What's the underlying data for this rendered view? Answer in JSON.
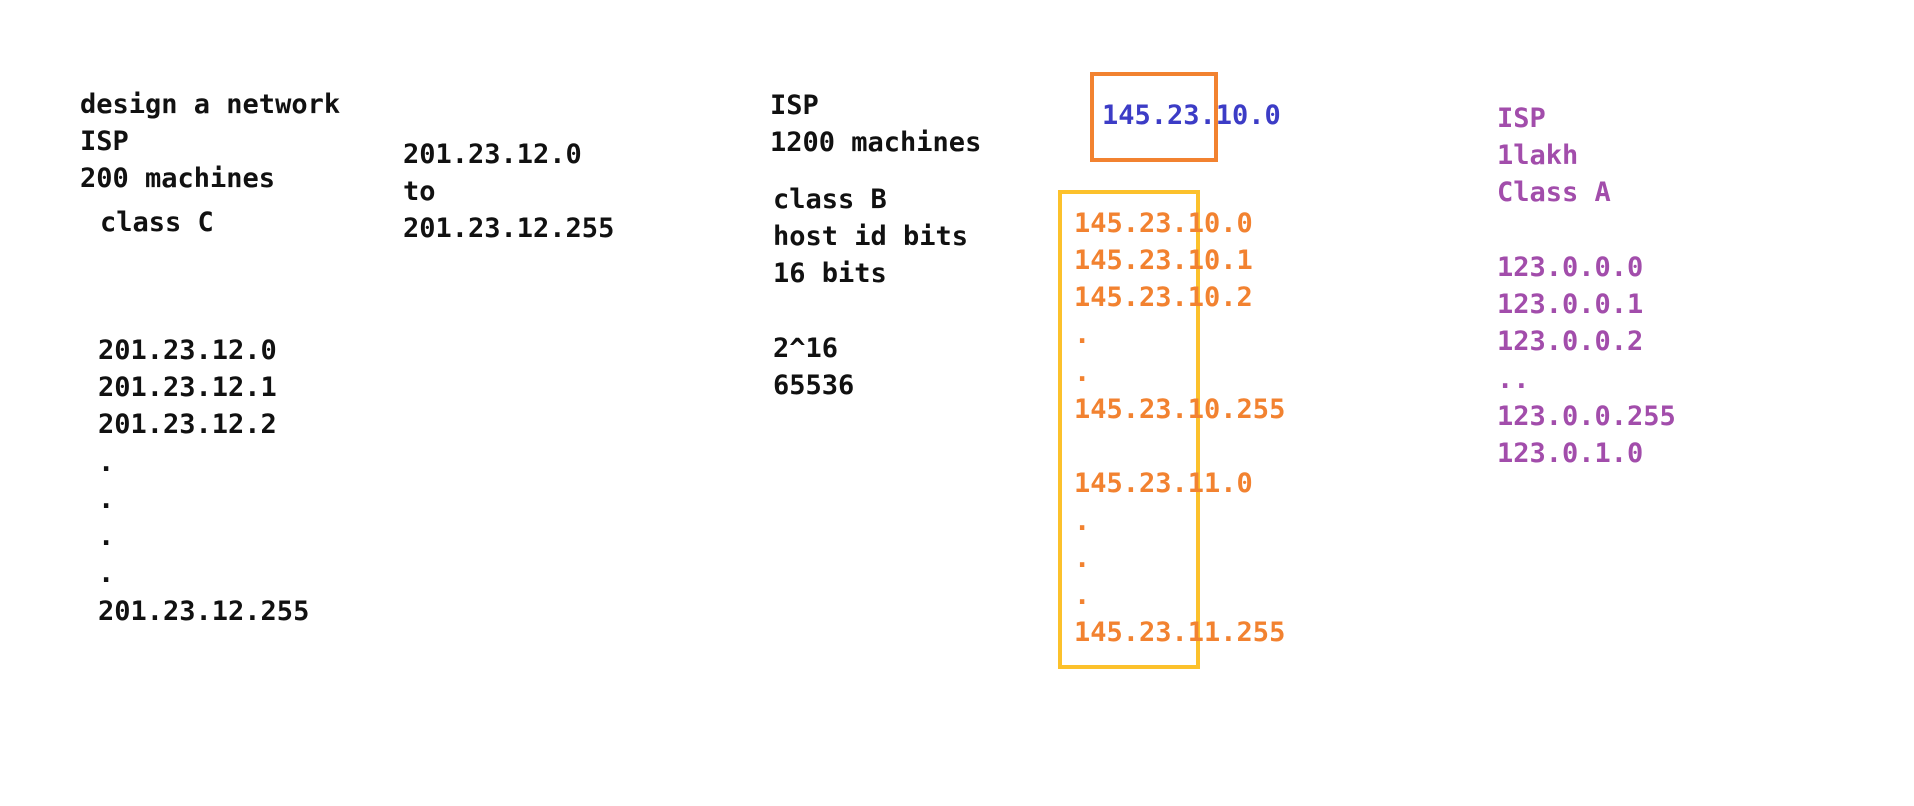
{
  "col1": {
    "line1": "design a network",
    "line2": "ISP",
    "line3": "200 machines",
    "line4": "class C",
    "addresses": [
      "201.23.12.0",
      "201.23.12.1",
      "201.23.12.2",
      ".",
      ".",
      ".",
      ".",
      "201.23.12.255"
    ]
  },
  "col2": {
    "range_start": "201.23.12.0",
    "range_to": "to",
    "range_end": "201.23.12.255"
  },
  "col3": {
    "line1": "ISP",
    "line2": "1200 machines",
    "line3": "class B",
    "line4": "host id bits",
    "line5": "16 bits",
    "line6": "2^16",
    "line7": "65536"
  },
  "col4": {
    "network_id": "145.23.10.0",
    "addresses": [
      "145.23.10.0",
      "145.23.10.1",
      "145.23.10.2",
      ".",
      ".",
      "145.23.10.255"
    ],
    "addresses2": [
      "145.23.11.0",
      ".",
      ".",
      ".",
      "145.23.11.255"
    ]
  },
  "col5": {
    "line1": "ISP",
    "line2": "1lakh",
    "line3": "Class A",
    "addresses": [
      "123.0.0.0",
      "123.0.0.1",
      "123.0.0.2",
      "..",
      "123.0.0.255",
      "123.0.1.0"
    ]
  },
  "colors": {
    "blue": "#3c3cc6",
    "orange": "#f28230",
    "yellow": "#fcc12b",
    "purple": "#a24dab",
    "black": "#111111"
  }
}
